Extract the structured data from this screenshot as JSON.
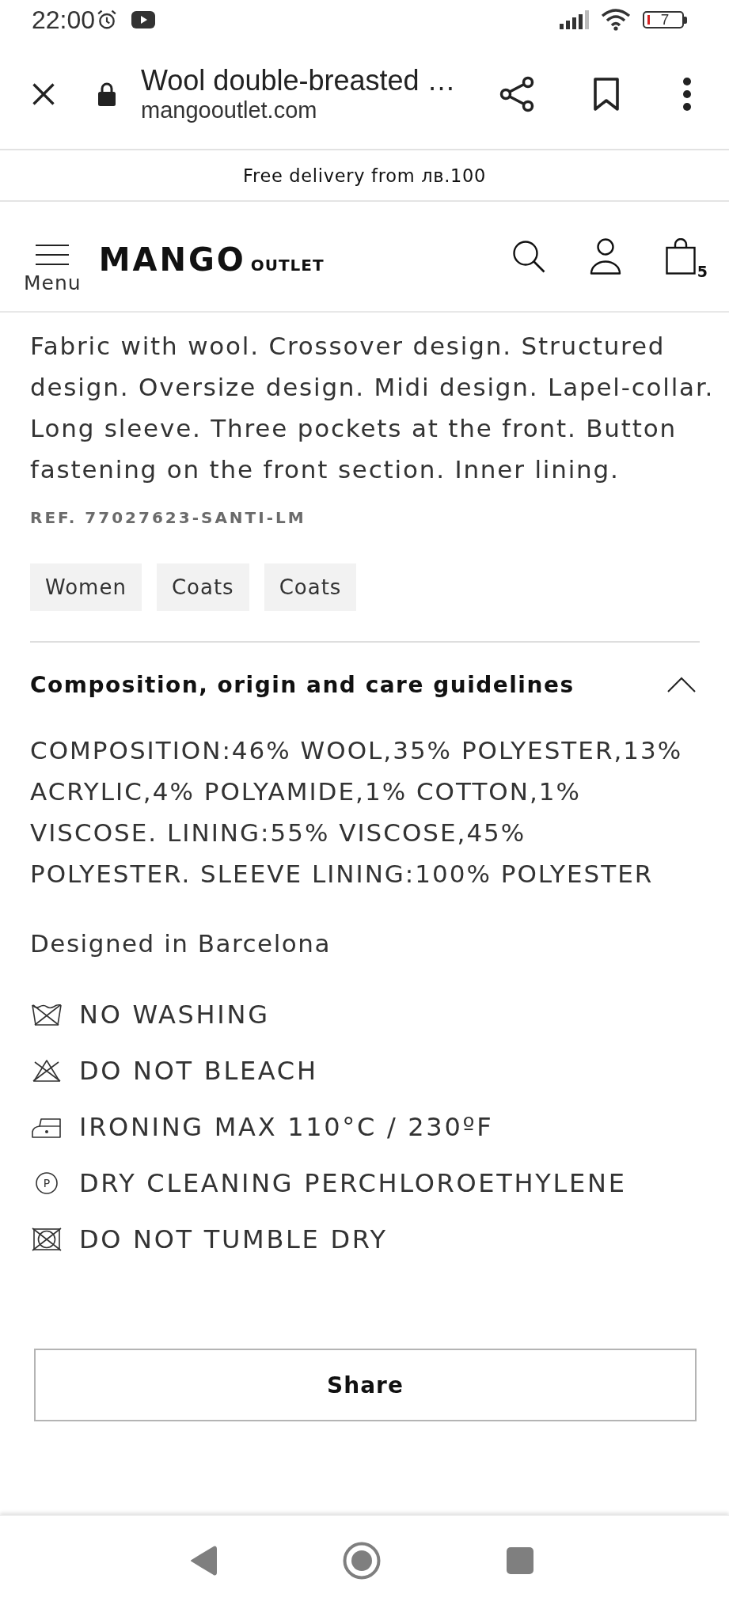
{
  "status_bar": {
    "time": "22:00",
    "battery": "7"
  },
  "browser_bar": {
    "title": "Wool double-breasted …",
    "url": "mangooutlet.com"
  },
  "promo_banner": {
    "text": "Free delivery from лв.100"
  },
  "header": {
    "menu_label": "Menu",
    "logo": "MANGO",
    "logo_suffix": "OUTLET",
    "cart_count": "5"
  },
  "product": {
    "description": "Fabric with wool. Crossover design. Structured design. Oversize design. Midi design. Lapel-collar. Long sleeve. Three pockets at the front. Button fastening on the front section. Inner lining.",
    "reference": "REF. 77027623-SANTI-LM",
    "tags": [
      "Women",
      "Coats",
      "Coats"
    ]
  },
  "care_section": {
    "title": "Composition, origin and care guidelines",
    "expanded": true,
    "composition": "COMPOSITION:46% WOOL,35% POLYESTER,13% ACRYLIC,4% POLYAMIDE,1% COTTON,1% VISCOSE. LINING:55% VISCOSE,45% POLYESTER. SLEEVE LINING:100% POLYESTER",
    "origin": "Designed in Barcelona",
    "care_items": [
      {
        "kind": "no_wash",
        "text": "NO WASHING"
      },
      {
        "kind": "no_bleach",
        "text": "DO NOT BLEACH"
      },
      {
        "kind": "iron",
        "text": "IRONING MAX 110°C / 230ºF"
      },
      {
        "kind": "dry_clean",
        "symbol": "P",
        "text": "DRY CLEANING PERCHLOROETHYLENE"
      },
      {
        "kind": "no_tumble_dry",
        "text": "DO NOT TUMBLE DRY"
      }
    ]
  },
  "share_button": {
    "label": "Share"
  }
}
